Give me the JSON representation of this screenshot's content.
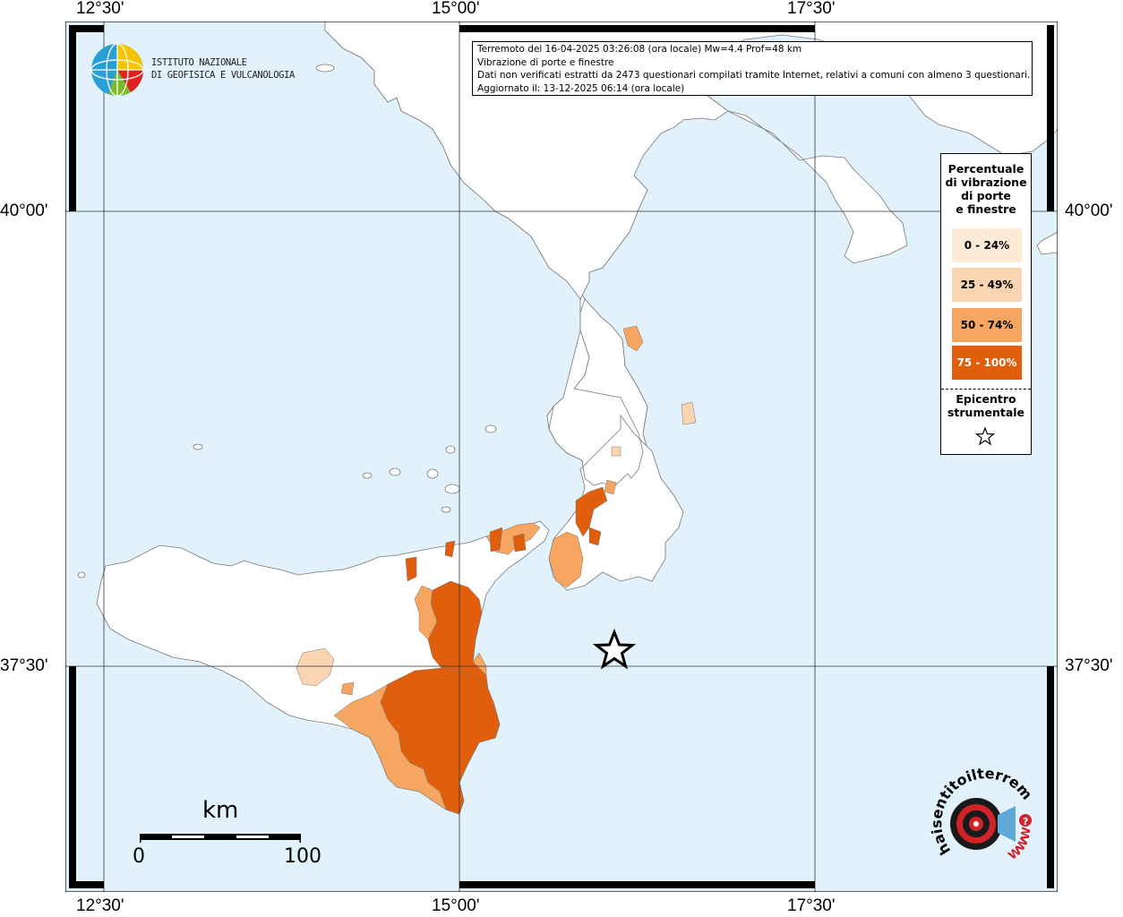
{
  "info": {
    "line1": "Terremoto del 16-04-2025 03:26:08 (ora locale) Mw=4.4 Prof=48 km",
    "line2": "Vibrazione di porte e finestre",
    "line3": "Dati non verificati estratti da 2473 questionari compilati tramite Internet, relativi a comuni con almeno 3 questionari.",
    "line4": "Aggiornato il: 13-12-2025 06:14 (ora locale)"
  },
  "axes": {
    "lon_top": [
      "12°30'",
      "15°00'",
      "17°30'"
    ],
    "lon_bottom": [
      "12°30'",
      "15°00'",
      "17°30'"
    ],
    "lat_left": [
      "40°00'",
      "37°30'"
    ],
    "lat_right": [
      "40°00'",
      "37°30'"
    ]
  },
  "legend": {
    "title_lines": [
      "Percentuale",
      "di vibrazione",
      "di porte",
      "e finestre"
    ],
    "classes": [
      {
        "label": "0 - 24%",
        "color": "#fdebd8",
        "text_color": "#000000"
      },
      {
        "label": "25 - 49%",
        "color": "#fbd4b1",
        "text_color": "#000000"
      },
      {
        "label": "50 - 74%",
        "color": "#f7a662",
        "text_color": "#000000"
      },
      {
        "label": "75 - 100%",
        "color": "#e05e0c",
        "text_color": "#ffffff"
      }
    ],
    "epicenter_lines": [
      "Epicentro",
      "strumentale"
    ]
  },
  "logo": {
    "ingv_line1": "ISTITUTO NAZIONALE",
    "ingv_line2": "DI GEOFISICA E VULCANOLOGIA",
    "hsit_text": "haisentitoilterremoto.it",
    "hsit_www": "WWW."
  },
  "scale": {
    "unit": "km",
    "min": "0",
    "max": "100"
  },
  "colors": {
    "sea": "#e1f2fc",
    "land": "#ffffff",
    "border": "#999999",
    "frame": "#000000"
  },
  "epicenter": {
    "symbol": "star",
    "lon": 15.94,
    "lat": 37.61
  }
}
